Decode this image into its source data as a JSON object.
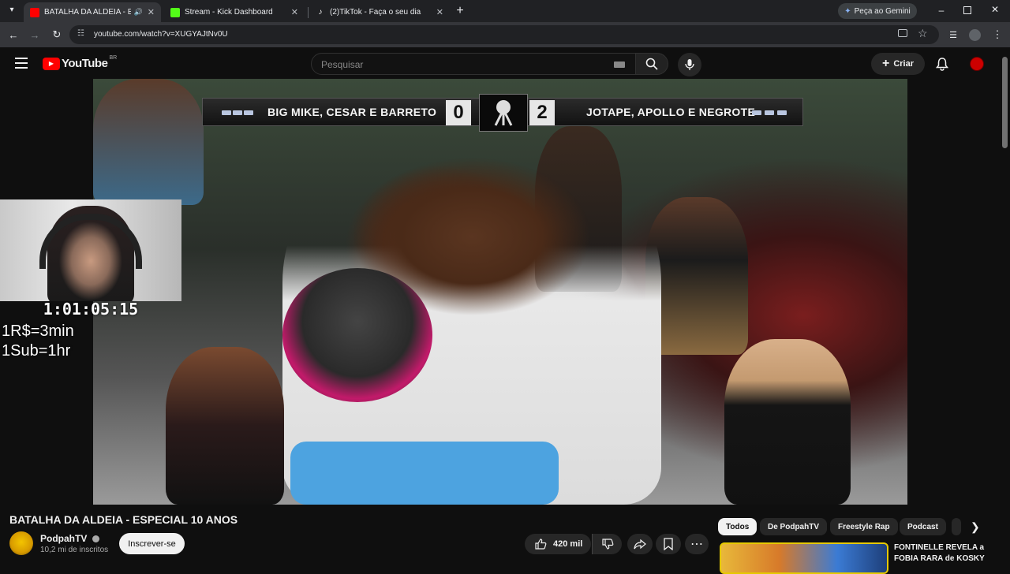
{
  "browser": {
    "tabs": [
      {
        "title": "BATALHA DA ALDEIA - ESPECIAL 10 ANOS",
        "favicon_color": "#ff0000",
        "active": true
      },
      {
        "title": "Stream - Kick Dashboard",
        "favicon_color": "#53fc18",
        "active": false
      },
      {
        "title": "(2)TikTok - Faça o seu dia",
        "favicon_color": "#ffffff",
        "active": false
      }
    ],
    "new_tab": "+",
    "gemini_button": "Peça ao Gemini",
    "url": "youtube.com/watch?v=XUGYAJtNv0U"
  },
  "youtube": {
    "logo_text": "YouTube",
    "region": "BR",
    "search_placeholder": "Pesquisar",
    "create_label": "Criar",
    "accent": "#ff0000"
  },
  "video": {
    "scoreboard": {
      "left_team": "BIG MIKE, CESAR E BARRETO",
      "left_score": "0",
      "right_score": "2",
      "right_team": "JOTAPE, APOLLO E NEGROTE"
    }
  },
  "stream_overlay": {
    "timer": "1:01:05:15",
    "line1": "1R$=3min",
    "line2": "1Sub=1hr"
  },
  "watch": {
    "title": "BATALHA DA ALDEIA - ESPECIAL 10 ANOS",
    "channel_name": "PodpahTV",
    "subscribers": "10,2 mi de inscritos",
    "subscribe_label": "Inscrever-se",
    "likes": "420 mil"
  },
  "recommendations": {
    "chips": [
      "Todos",
      "De PodpahTV",
      "Freestyle Rap",
      "Podcast"
    ],
    "first_title": "FONTINELLE REVELA a FOBIA RARA de KOSKY"
  }
}
